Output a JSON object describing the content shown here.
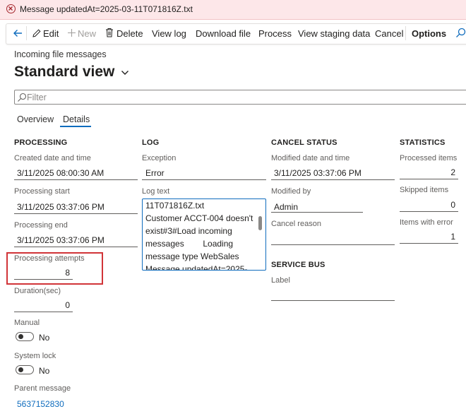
{
  "window": {
    "title": "Message updatedAt=2025-03-11T071816Z.txt"
  },
  "toolbar": {
    "edit": "Edit",
    "new": "New",
    "delete": "Delete",
    "view_log": "View log",
    "download_file": "Download file",
    "process": "Process",
    "view_staging_data": "View staging data",
    "cancel": "Cancel",
    "options": "Options"
  },
  "page": {
    "caption": "Incoming file messages",
    "view_name": "Standard view"
  },
  "filter": {
    "placeholder": "Filter"
  },
  "tabs": [
    {
      "label": "Overview",
      "active": false
    },
    {
      "label": "Details",
      "active": true
    }
  ],
  "processing": {
    "heading": "PROCESSING",
    "created_label": "Created date and time",
    "created_value": "3/11/2025 08:00:30 AM",
    "start_label": "Processing start",
    "start_value": "3/11/2025 03:37:06 PM",
    "end_label": "Processing end",
    "end_value": "3/11/2025 03:37:06 PM",
    "attempts_label": "Processing attempts",
    "attempts_value": "8",
    "duration_label": "Duration(sec)",
    "duration_value": "0",
    "manual_label": "Manual",
    "manual_value": "No",
    "syslock_label": "System lock",
    "syslock_value": "No",
    "parent_label": "Parent message",
    "parent_value": "5637152830"
  },
  "log": {
    "heading": "LOG",
    "exception_label": "Exception",
    "exception_value": "Error",
    "logtext_label": "Log text",
    "logtext_value": "11T071816Z.txt\nCustomer ACCT-004 doesn't exist#3#Load incoming messages        Loading message type WebSales Message updatedAt=2025-"
  },
  "cancel_status": {
    "heading": "CANCEL STATUS",
    "modified_dt_label": "Modified date and time",
    "modified_dt_value": "3/11/2025 03:37:06 PM",
    "modified_by_label": "Modified by",
    "modified_by_value": "Admin",
    "cancel_reason_label": "Cancel reason",
    "cancel_reason_value": ""
  },
  "service_bus": {
    "heading": "SERVICE BUS",
    "label_label": "Label",
    "label_value": ""
  },
  "statistics": {
    "heading": "STATISTICS",
    "processed_label": "Processed items",
    "processed_value": "2",
    "skipped_label": "Skipped items",
    "skipped_value": "0",
    "error_label": "Items with error",
    "error_value": "1"
  },
  "colors": {
    "accent": "#0f6cbd",
    "highlight": "#d13438",
    "titlebar_bg": "#fde7e9"
  }
}
